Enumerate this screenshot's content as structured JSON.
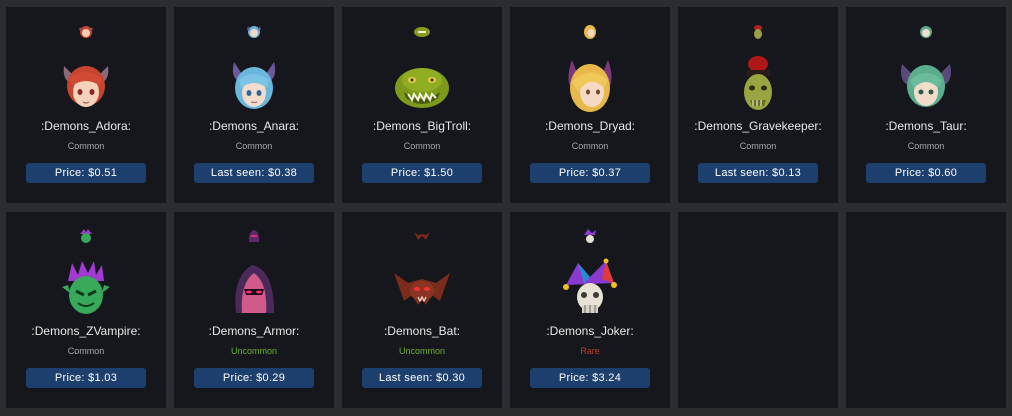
{
  "items": [
    {
      "name": ":Demons_Adora:",
      "rarity": "Common",
      "price_label": "Price: $0.51",
      "rarity_color": "#a8a8a8",
      "icon": "demon-adora-icon"
    },
    {
      "name": ":Demons_Anara:",
      "rarity": "Common",
      "price_label": "Last seen: $0.38",
      "rarity_color": "#a8a8a8",
      "icon": "demon-anara-icon"
    },
    {
      "name": ":Demons_BigTroll:",
      "rarity": "Common",
      "price_label": "Price: $1.50",
      "rarity_color": "#a8a8a8",
      "icon": "demon-bigtroll-icon"
    },
    {
      "name": ":Demons_Dryad:",
      "rarity": "Common",
      "price_label": "Price: $0.37",
      "rarity_color": "#a8a8a8",
      "icon": "demon-dryad-icon"
    },
    {
      "name": ":Demons_Gravekeeper:",
      "rarity": "Common",
      "price_label": "Last seen: $0.13",
      "rarity_color": "#a8a8a8",
      "icon": "demon-gravekeeper-icon"
    },
    {
      "name": ":Demons_Taur:",
      "rarity": "Common",
      "price_label": "Price: $0.60",
      "rarity_color": "#a8a8a8",
      "icon": "demon-taur-icon"
    },
    {
      "name": ":Demons_ZVampire:",
      "rarity": "Common",
      "price_label": "Price: $1.03",
      "rarity_color": "#a8a8a8",
      "icon": "demon-zvampire-icon"
    },
    {
      "name": ":Demons_Armor:",
      "rarity": "Uncommon",
      "price_label": "Price: $0.29",
      "rarity_color": "#6cae2e",
      "icon": "demon-armor-icon"
    },
    {
      "name": ":Demons_Bat:",
      "rarity": "Uncommon",
      "price_label": "Last seen: $0.30",
      "rarity_color": "#6cae2e",
      "icon": "demon-bat-icon"
    },
    {
      "name": ":Demons_Joker:",
      "rarity": "Rare",
      "price_label": "Price: $3.24",
      "rarity_color": "#c0392b",
      "icon": "demon-joker-icon"
    }
  ]
}
